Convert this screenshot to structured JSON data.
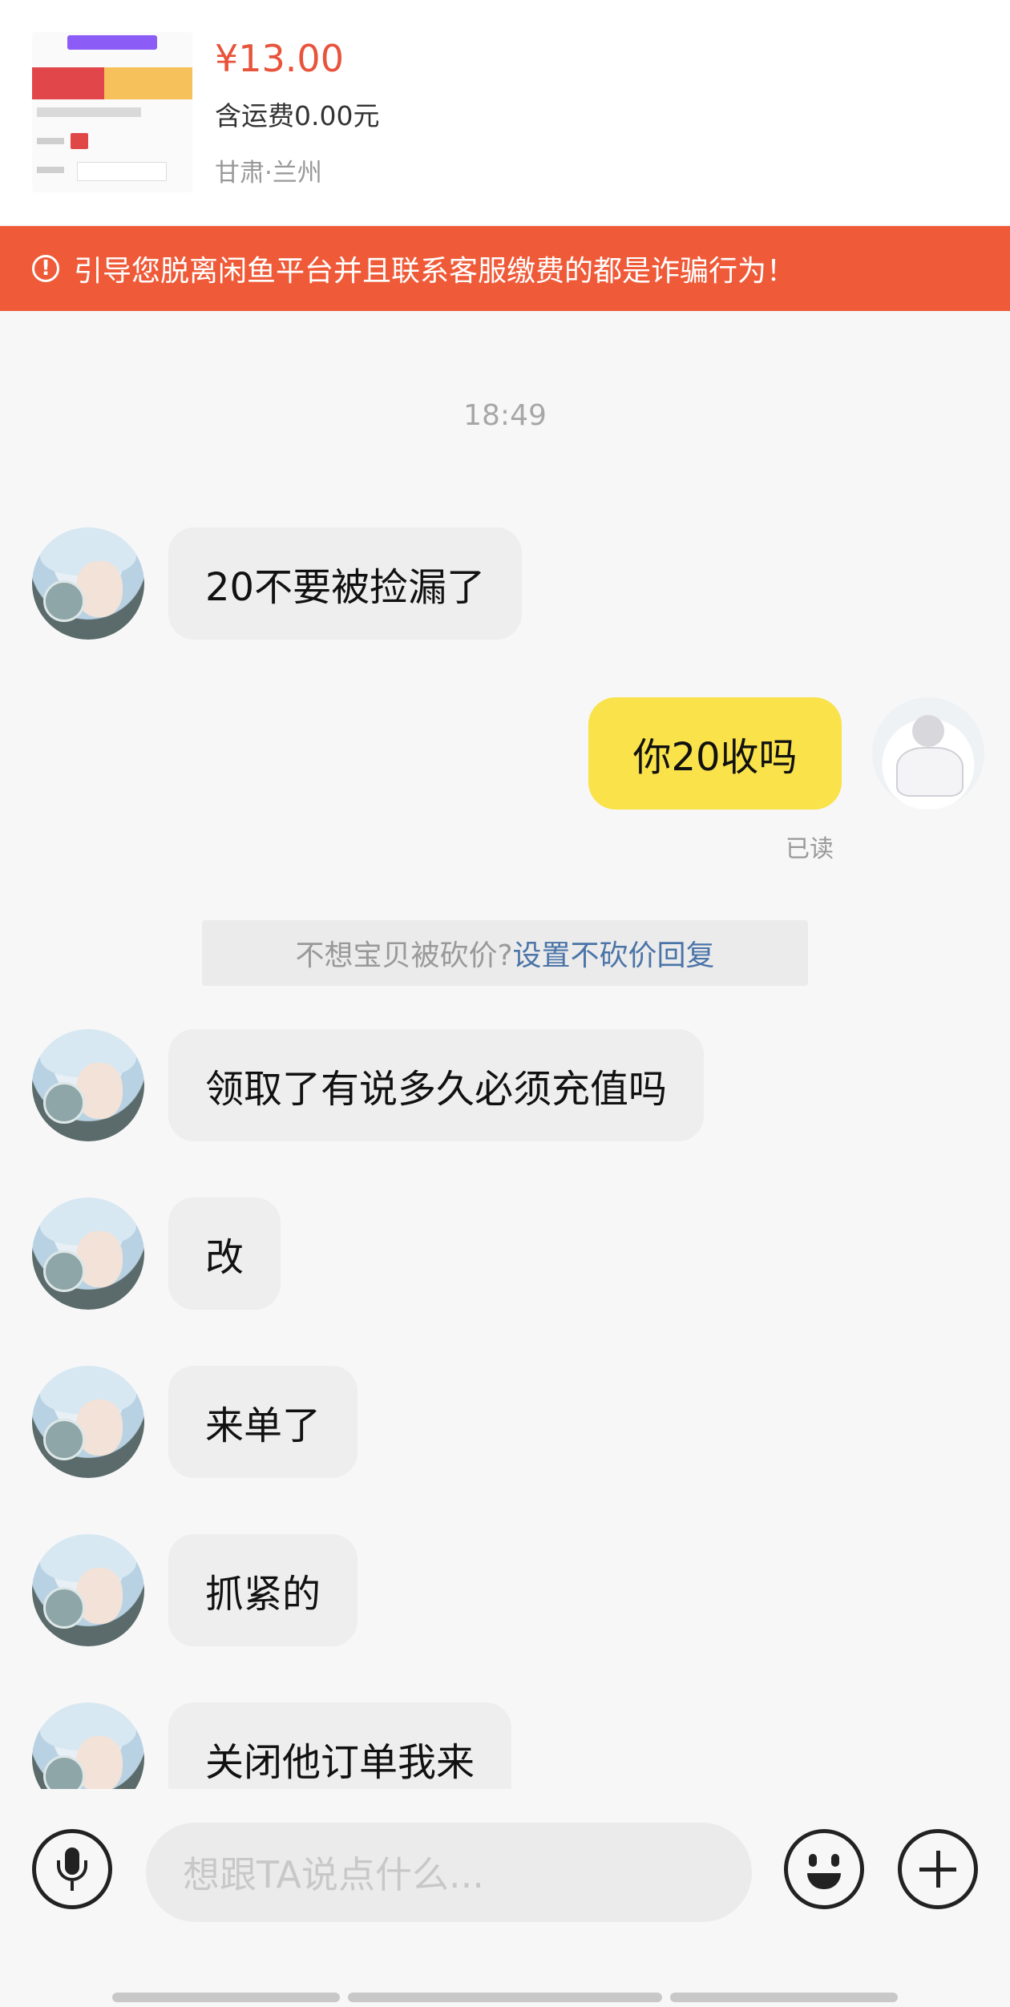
{
  "product": {
    "price": "¥13.00",
    "shipping": "含运费0.00元",
    "location": "甘肃·兰州"
  },
  "warning": {
    "icon": "exclamation-circle-icon",
    "text": "引导您脱离闲鱼平台并且联系客服缴费的都是诈骗行为！"
  },
  "chat": {
    "timestamp": "18:49",
    "messages": [
      {
        "from": "other",
        "text": "20不要被捡漏了"
      },
      {
        "from": "self",
        "text": "你20收吗",
        "status": "已读"
      },
      {
        "from": "other",
        "text": "领取了有说多久必须充值吗"
      },
      {
        "from": "other",
        "text": "改"
      },
      {
        "from": "other",
        "text": "来单了"
      },
      {
        "from": "other",
        "text": "抓紧的"
      },
      {
        "from": "other",
        "text": "关闭他订单我来"
      }
    ],
    "hint": {
      "question": "不想宝贝被砍价?",
      "link": "设置不砍价回复"
    }
  },
  "input_bar": {
    "voice_icon": "microphone-icon",
    "placeholder": "想跟TA说点什么...",
    "emoji_icon": "smile-icon",
    "plus_icon": "plus-icon"
  },
  "colors": {
    "warning_bg": "#ef5b39",
    "price": "#e8533c",
    "self_bubble": "#f9e24a",
    "other_bubble": "#eeeeee",
    "link": "#4b74a8"
  }
}
